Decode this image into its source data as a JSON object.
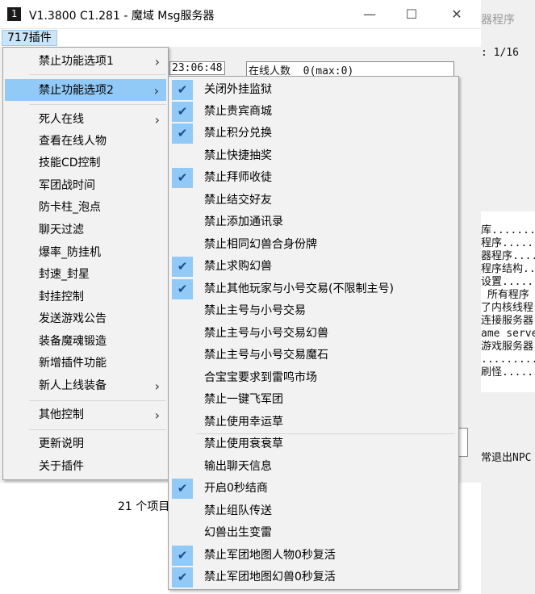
{
  "window": {
    "title": "V1.3800 C1.281  - 魔域  Msg服务器",
    "app_icon_text": "1",
    "menubar_item": "717插件"
  },
  "background": {
    "back_window_title": "器程序",
    "page_counter": ": 1/16",
    "time_text": "23:06:48",
    "online_text": "在线人数  0(max:0)",
    "log_lines": [
      "库.........",
      "程序.......",
      "器程序.....",
      "程序结构...",
      "设置.......",
      " 所有程序",
      "了内核线程",
      "连接服务器",
      "ame server",
      "游戏服务器",
      "...........",
      "刷怪.......",
      "常退出NPC"
    ],
    "explorer_count": "21 个项目"
  },
  "menu_main": {
    "items": [
      {
        "label": "禁止功能选项1",
        "submenu": true
      },
      {
        "label": "禁止功能选项2",
        "submenu": true,
        "highlighted": true
      },
      {
        "label": "死人在线",
        "submenu": true
      },
      {
        "label": "查看在线人物",
        "submenu": false
      },
      {
        "label": "技能CD控制",
        "submenu": false
      },
      {
        "label": "军团战时间",
        "submenu": false
      },
      {
        "label": "防卡柱_泡点",
        "submenu": false
      },
      {
        "label": "聊天过滤",
        "submenu": false
      },
      {
        "label": "爆率_防挂机",
        "submenu": false
      },
      {
        "label": "封速_封星",
        "submenu": false
      },
      {
        "label": "封挂控制",
        "submenu": false
      },
      {
        "label": "发送游戏公告",
        "submenu": false
      },
      {
        "label": "装备魔魂锻造",
        "submenu": false
      },
      {
        "label": "新增插件功能",
        "submenu": false
      },
      {
        "label": "新人上线装备",
        "submenu": true
      },
      {
        "label": "其他控制",
        "submenu": true
      },
      {
        "label": "更新说明",
        "submenu": false
      },
      {
        "label": "关于插件",
        "submenu": false
      }
    ]
  },
  "menu_sub": {
    "items": [
      {
        "label": "关闭外挂监狱",
        "checked": true
      },
      {
        "label": "禁止贵宾商城",
        "checked": true
      },
      {
        "label": "禁止积分兑换",
        "checked": true
      },
      {
        "label": "禁止快捷抽奖",
        "checked": false
      },
      {
        "label": "禁止拜师收徒",
        "checked": true
      },
      {
        "label": "禁止结交好友",
        "checked": false
      },
      {
        "label": "禁止添加通讯录",
        "checked": false
      },
      {
        "label": "禁止相同幻兽合身份牌",
        "checked": false
      },
      {
        "label": "禁止求购幻兽",
        "checked": true
      },
      {
        "label": "禁止其他玩家与小号交易(不限制主号)",
        "checked": true
      },
      {
        "label": "禁止主号与小号交易",
        "checked": false
      },
      {
        "label": "禁止主号与小号交易幻兽",
        "checked": false
      },
      {
        "label": "禁止主号与小号交易魔石",
        "checked": false
      },
      {
        "label": "合宝宝要求到雷鸣市场",
        "checked": false
      },
      {
        "label": "禁止一键飞军团",
        "checked": false
      },
      {
        "label": "禁止使用幸运草",
        "checked": false
      },
      {
        "label": "禁止使用衰衰草",
        "checked": false
      },
      {
        "label": "输出聊天信息",
        "checked": false
      },
      {
        "label": "开启0秒结商",
        "checked": true
      },
      {
        "label": "禁止组队传送",
        "checked": false
      },
      {
        "label": "幻兽出生变雷",
        "checked": false
      },
      {
        "label": "禁止军团地图人物0秒复活",
        "checked": true
      },
      {
        "label": "禁止军团地图幻兽0秒复活",
        "checked": true
      }
    ],
    "check_glyph": "✔"
  }
}
